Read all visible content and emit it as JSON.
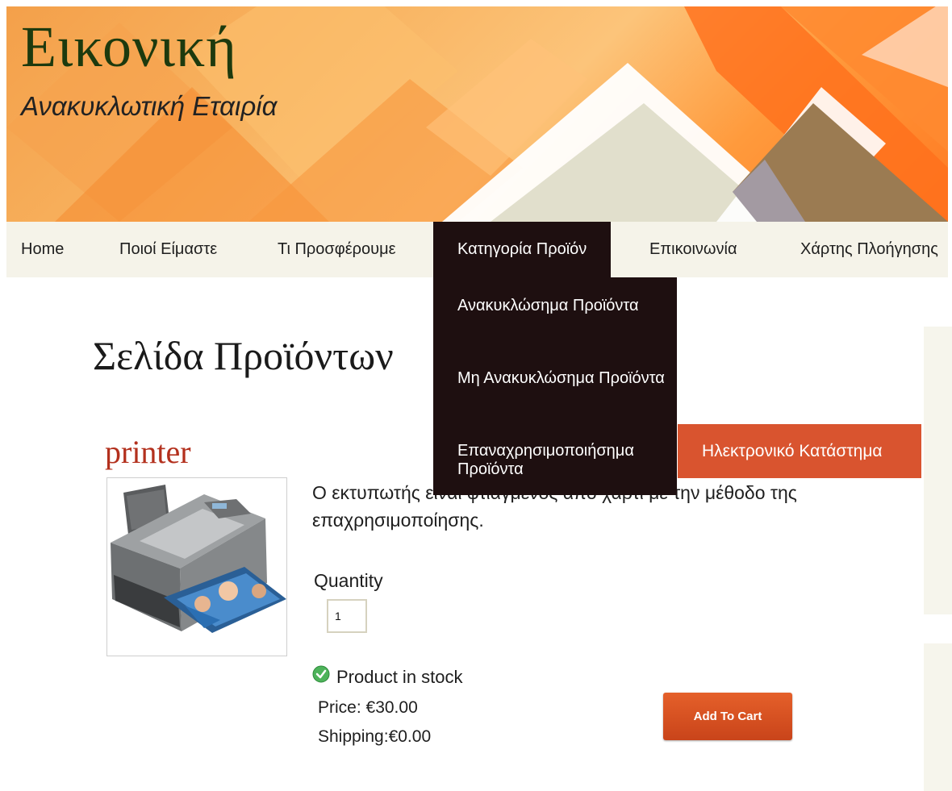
{
  "header": {
    "title": "Εικονική",
    "subtitle": "Ανακυκλωτική Εταιρία"
  },
  "nav": {
    "items": [
      {
        "label": "Home"
      },
      {
        "label": "Ποιοί Είμαστε"
      },
      {
        "label": "Τι Προσφέρουμε"
      },
      {
        "label": "Κατηγορία Προϊόν"
      },
      {
        "label": "Επικοινωνία"
      },
      {
        "label": "Χάρτης Πλοήγησης"
      }
    ],
    "active_index": 3,
    "dropdown": [
      {
        "label": "Ανακυκλώσημα Προϊόντα"
      },
      {
        "label": "Μη Ανακυκλώσημα Προϊόντα"
      },
      {
        "label": "Επαναχρησιμοποιήσημα Προϊόντα"
      }
    ]
  },
  "page": {
    "title": "Σελίδα Προϊόντων"
  },
  "sidebar": {
    "eshop_label": "Ηλεκτρονικό Κατάστημα"
  },
  "product": {
    "name": "printer",
    "description": "Ο εκτυπωτής είναι φτιαγμένος από χαρτί με την μέθοδο της επαχρησιμοποίησης.",
    "quantity_label": "Quantity",
    "quantity_value": "1",
    "stock_text": "Product in stock",
    "price_text": "Price: €30.00",
    "shipping_text": "Shipping:€0.00",
    "add_to_cart_label": "Add To Cart"
  },
  "colors": {
    "nav_active_bg": "#1e0f10",
    "eshop_bg": "#d9542f",
    "product_name": "#b3301d",
    "title_green": "#1d3a0e"
  }
}
